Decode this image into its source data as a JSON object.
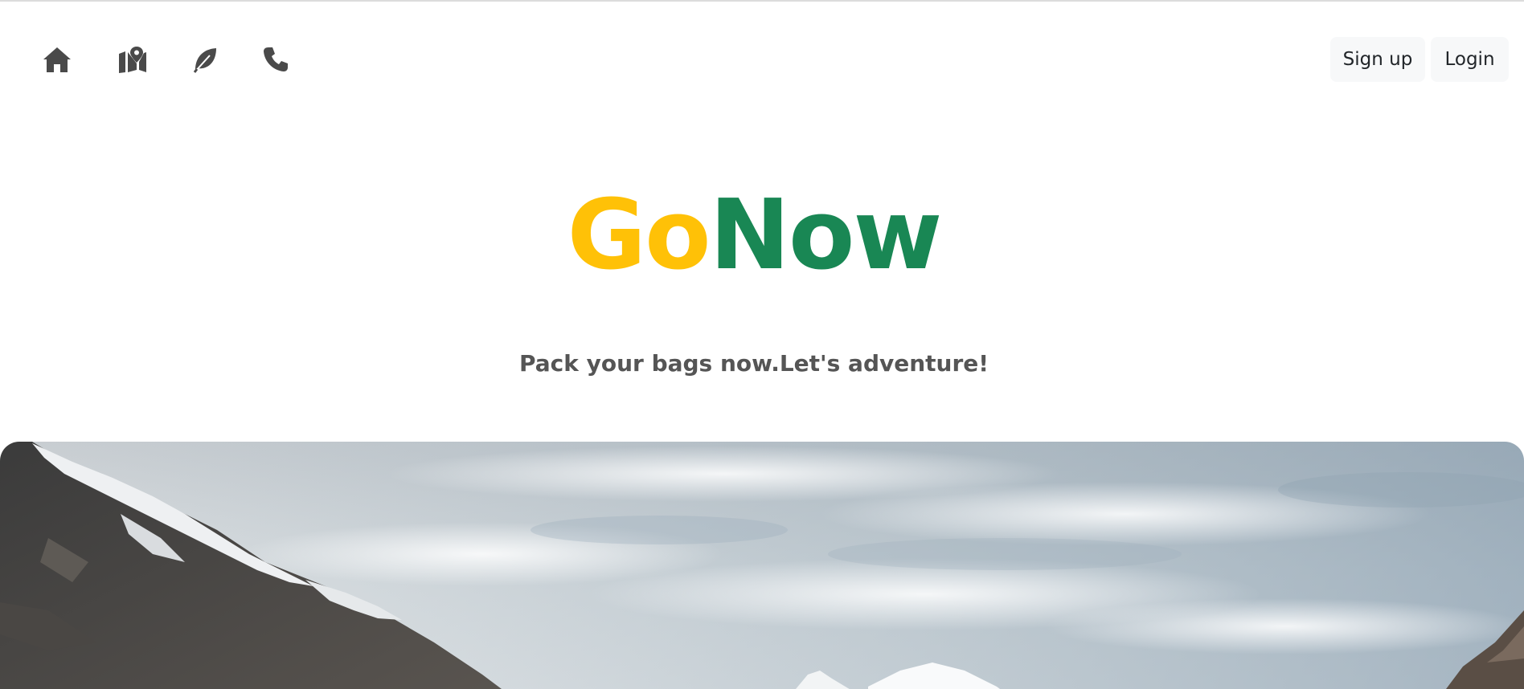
{
  "nav": {
    "icons": [
      {
        "name": "home-icon",
        "label": "Home"
      },
      {
        "name": "map-icon",
        "label": "Map"
      },
      {
        "name": "leaf-icon",
        "label": "Eco"
      },
      {
        "name": "phone-icon",
        "label": "Contact"
      }
    ],
    "signup_label": "Sign up",
    "login_label": "Login"
  },
  "hero": {
    "brand_part1": "Go",
    "brand_part2": "Now",
    "tagline": "Pack your bags now.Let's adventure!"
  },
  "colors": {
    "brand_yellow": "#ffc107",
    "brand_green": "#198754",
    "icon_gray": "#4a4a4a",
    "tagline_gray": "#555555"
  },
  "image": {
    "subject": "snowy-mountain-landscape"
  }
}
